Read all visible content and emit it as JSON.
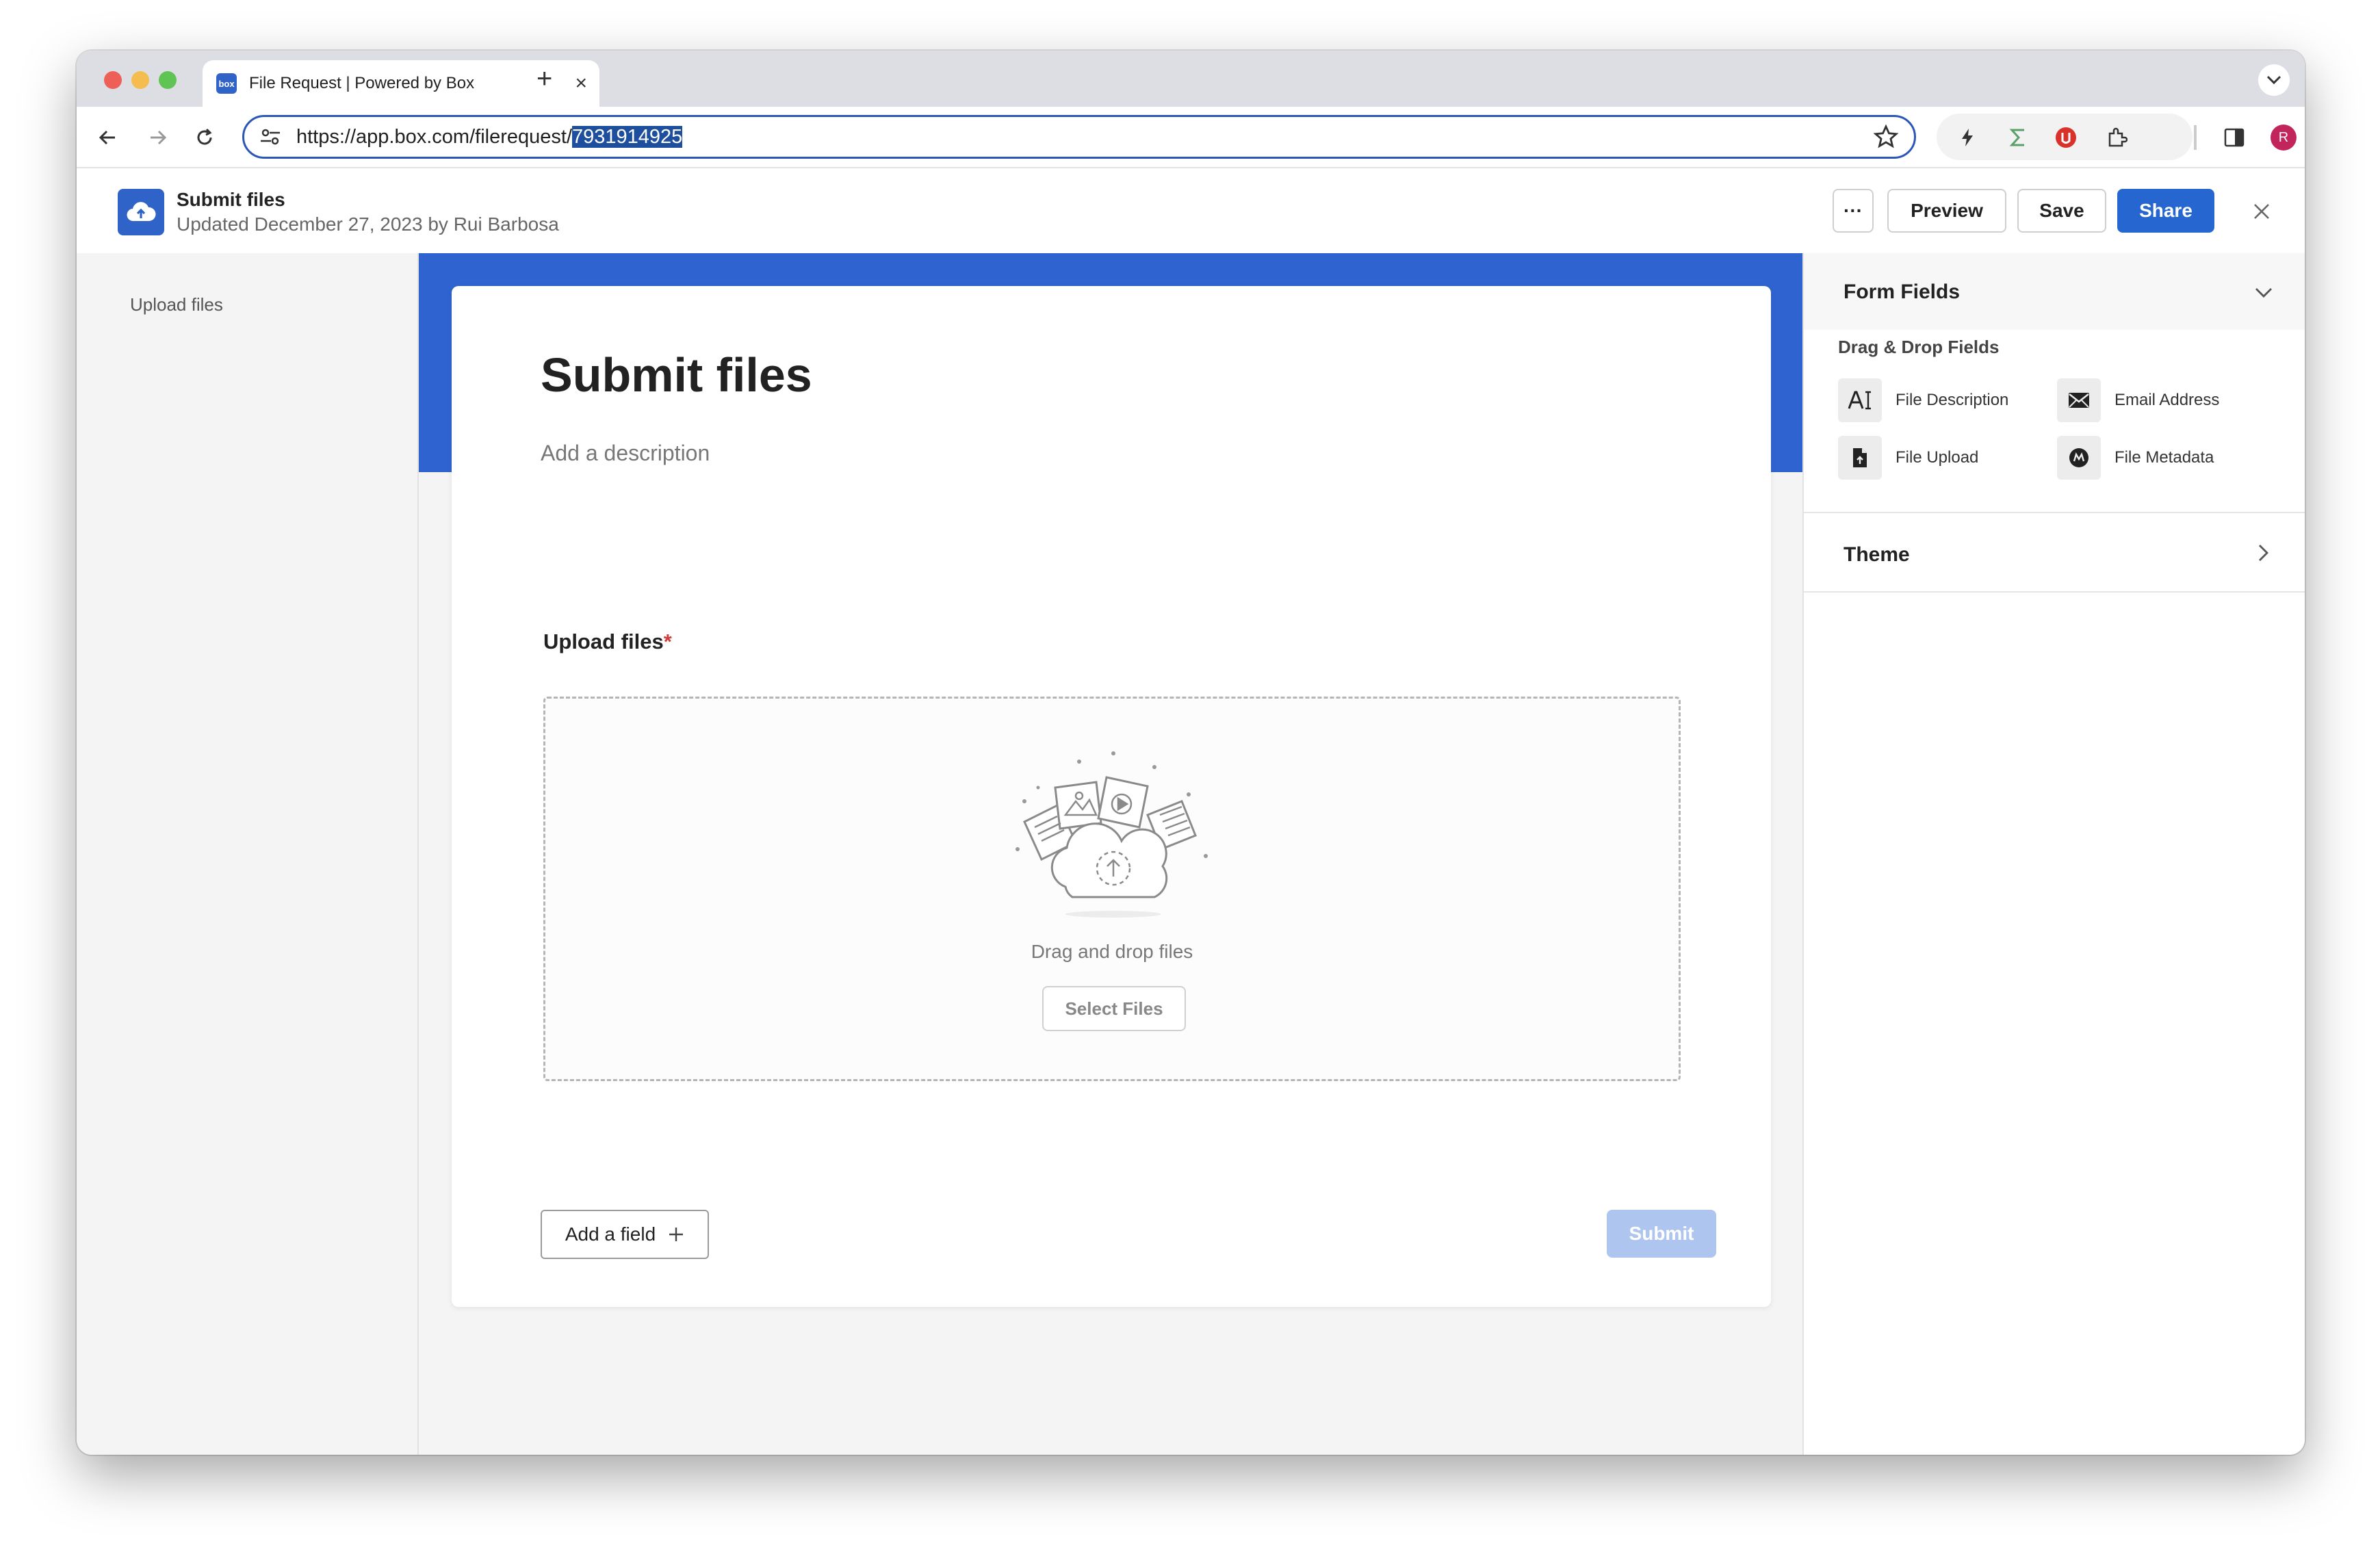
{
  "browser": {
    "tab_title": "File Request | Powered by Box",
    "tab_favicon_text": "box",
    "url_prefix": "https://app.box.com/filerequest/",
    "url_highlight": "7931914925",
    "profile_initial": "R"
  },
  "header": {
    "title": "Submit files",
    "subtitle": "Updated December 27, 2023 by Rui Barbosa",
    "more_label": "···",
    "preview_label": "Preview",
    "save_label": "Save",
    "share_label": "Share"
  },
  "left_nav": {
    "items": [
      {
        "label": "Upload files"
      }
    ]
  },
  "form": {
    "title": "Submit files",
    "description_placeholder": "Add a description",
    "field_label": "Upload files",
    "required_mark": "*",
    "dropzone_text": "Drag and drop files",
    "select_files_label": "Select Files",
    "add_field_label": "Add a field",
    "submit_label": "Submit"
  },
  "right_panel": {
    "section_title": "Form Fields",
    "subsection_title": "Drag & Drop Fields",
    "fields": [
      {
        "label": "File Description",
        "icon": "text-field-icon"
      },
      {
        "label": "Email Address",
        "icon": "envelope-icon"
      },
      {
        "label": "File Upload",
        "icon": "file-icon"
      },
      {
        "label": "File Metadata",
        "icon": "metadata-icon"
      }
    ],
    "theme_title": "Theme"
  },
  "colors": {
    "brand_blue": "#2566d0",
    "banner_blue": "#2f63cf",
    "submit_disabled": "#aec6ef",
    "required_red": "#d33b3b"
  }
}
